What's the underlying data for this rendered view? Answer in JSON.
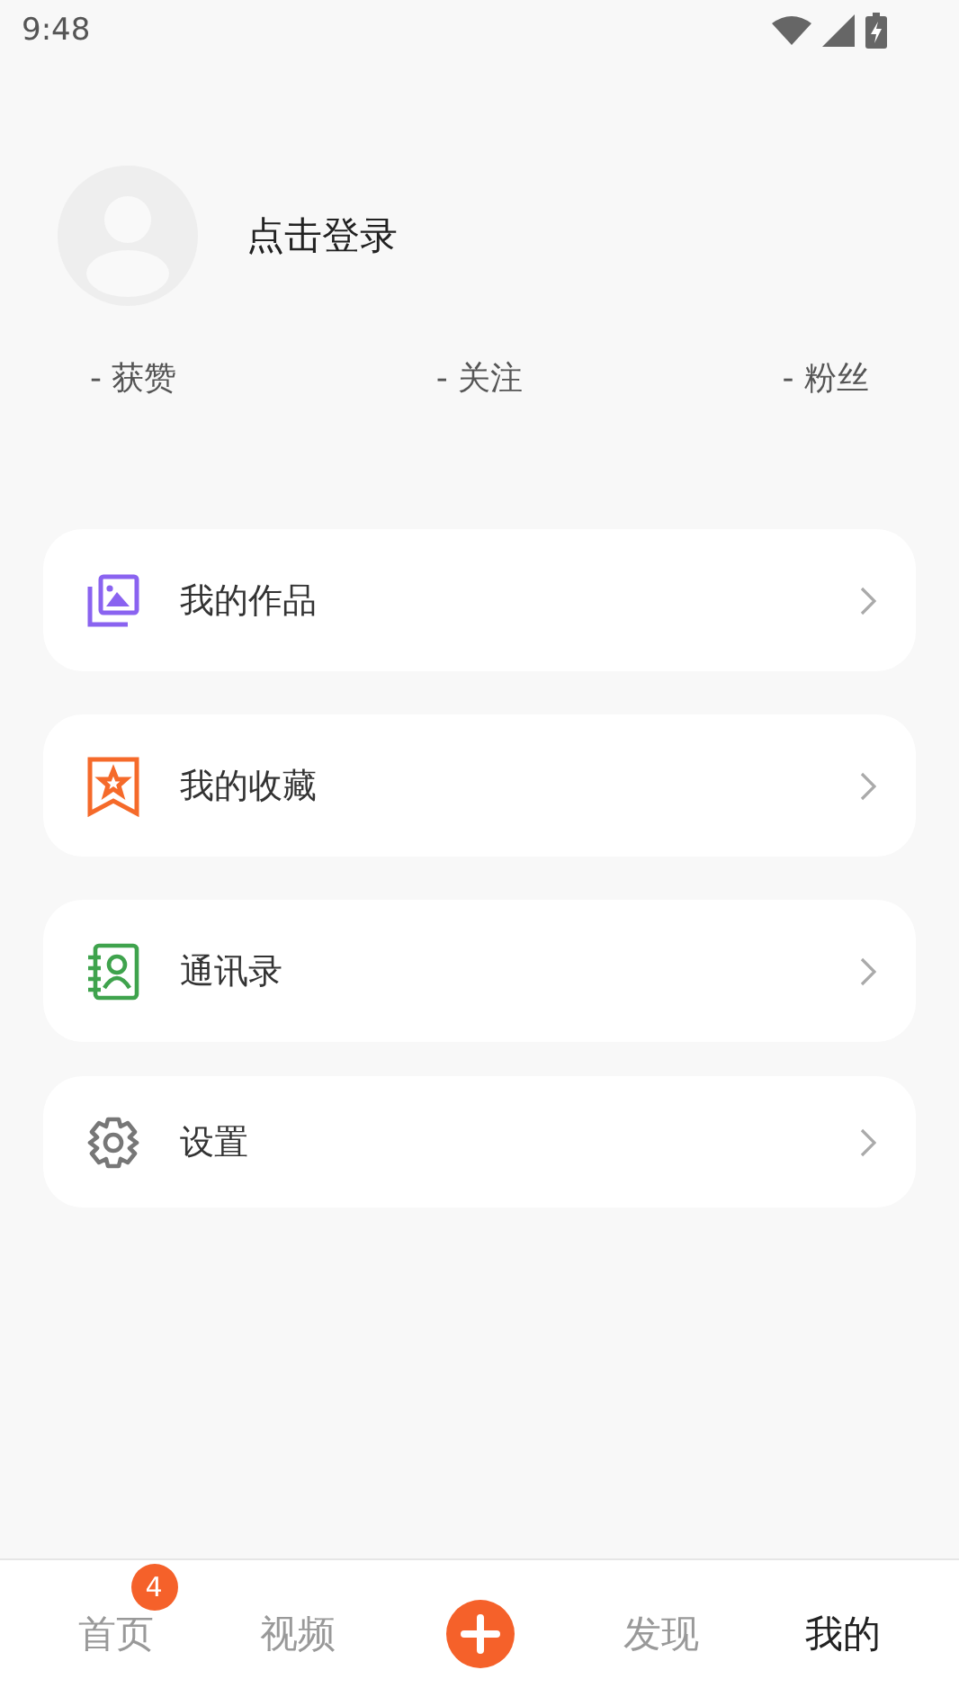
{
  "status_bar": {
    "time": "9:48"
  },
  "profile": {
    "login": "点击登录"
  },
  "stats": [
    "- 获赞",
    "- 关注",
    "- 粉丝"
  ],
  "menu": [
    {
      "kind": "works",
      "label": "我的作品"
    },
    {
      "kind": "favorites",
      "label": "我的收藏"
    },
    {
      "kind": "contacts",
      "label": "通讯录"
    },
    {
      "kind": "settings",
      "label": "设置"
    }
  ],
  "tabs": [
    {
      "kind": "tab",
      "label": "首页",
      "selected": false,
      "badge": "4"
    },
    {
      "kind": "tab",
      "label": "视频",
      "selected": false
    },
    {
      "kind": "add"
    },
    {
      "kind": "tab",
      "label": "发现",
      "selected": false
    },
    {
      "kind": "tab",
      "label": "我的",
      "selected": true
    }
  ]
}
